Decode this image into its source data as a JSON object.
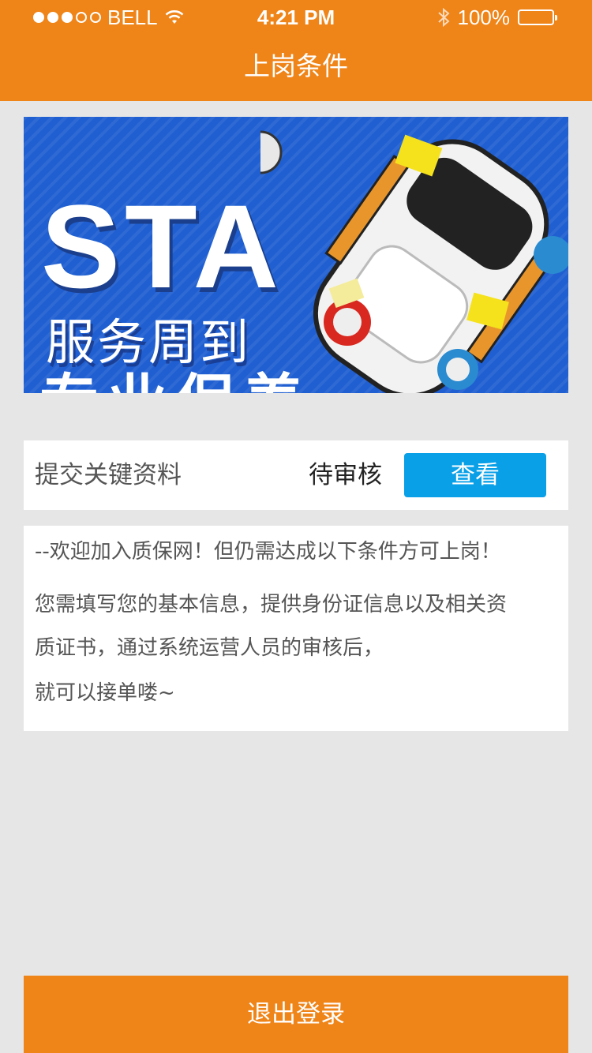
{
  "status_bar": {
    "carrier": "BELL",
    "time": "4:21 PM",
    "battery": "100%"
  },
  "header": {
    "title": "上岗条件"
  },
  "banner": {
    "logo_text": "STA",
    "slogan": "服务周到",
    "slogan_partial": "专业保养"
  },
  "status_row": {
    "label": "提交关键资料",
    "state": "待审核",
    "button_label": "查看"
  },
  "notice": {
    "lines": [
      "--欢迎加入质保网！但仍需达成以下条件方可上岗！",
      "您需填写您的基本信息，提供身份证信息以及相关资",
      "质证书，通过系统运营人员的审核后，",
      "就可以接单喽~"
    ]
  },
  "footer": {
    "logout_label": "退出登录"
  },
  "colors": {
    "primary": "#ef8418",
    "button_blue": "#0aa0e8",
    "background": "#e6e6e6"
  }
}
